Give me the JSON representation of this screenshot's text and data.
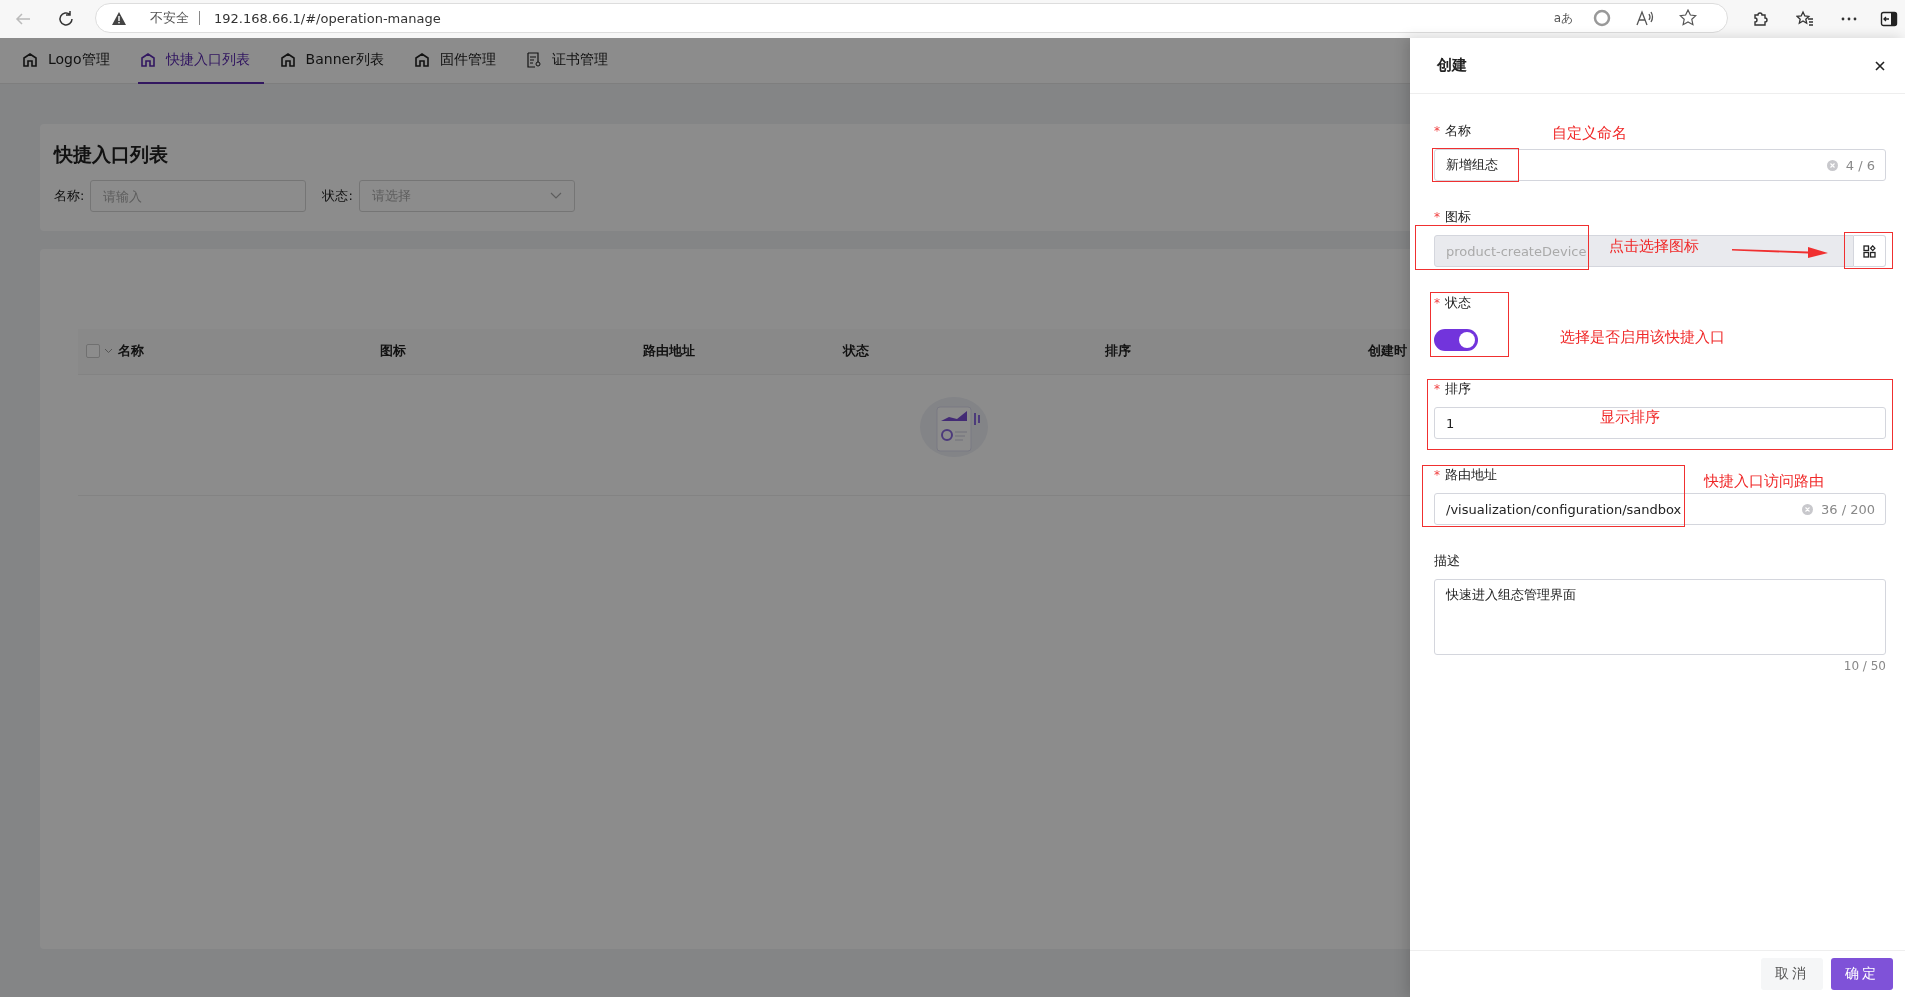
{
  "browser": {
    "security": "不安全",
    "url": "192.168.66.1/#/operation-manage",
    "reader_label": "aあ"
  },
  "tabs": [
    {
      "label": "Logo管理",
      "kind": "home",
      "selected": false
    },
    {
      "label": "快捷入口列表",
      "kind": "home",
      "selected": true
    },
    {
      "label": "Banner列表",
      "kind": "home",
      "selected": false
    },
    {
      "label": "固件管理",
      "kind": "home",
      "selected": false
    },
    {
      "label": "证书管理",
      "kind": "certificate",
      "selected": false
    }
  ],
  "page": {
    "title": "快捷入口列表",
    "filters": [
      {
        "kind": "input",
        "label": "名称:",
        "placeholder": "请输入"
      },
      {
        "kind": "select",
        "label": "状态:",
        "placeholder": "请选择"
      }
    ]
  },
  "table": {
    "select_all_checked": false,
    "columns": [
      "名称",
      "图标",
      "路由地址",
      "状态",
      "排序",
      "创建时"
    ]
  },
  "drawer": {
    "title": "创建",
    "fields": [
      {
        "kind": "text",
        "label": "名称",
        "required_mark": "*",
        "value": "新增组态",
        "counter": "4 / 6",
        "annotation": "自定义命名"
      },
      {
        "kind": "icon-picker",
        "label": "图标",
        "required_mark": "*",
        "value": "product-createDevice",
        "disabled": true,
        "annotation": "点击选择图标"
      },
      {
        "kind": "switch",
        "label": "状态",
        "required_mark": "*",
        "on": true,
        "annotation": "选择是否启用该快捷入口"
      },
      {
        "kind": "text",
        "label": "排序",
        "required_mark": "*",
        "value": "1",
        "annotation": "显示排序"
      },
      {
        "kind": "text",
        "label": "路由地址",
        "required_mark": "*",
        "value": "/visualization/configuration/sandbox",
        "counter": "36 / 200",
        "annotation": "快捷入口访问路由"
      },
      {
        "kind": "textarea",
        "label": "描述",
        "value": "快速进入组态管理界面",
        "counter": "10 / 50"
      }
    ],
    "buttons": [
      {
        "kind": "default",
        "label": "取消"
      },
      {
        "kind": "primary",
        "label": "确定"
      }
    ]
  }
}
